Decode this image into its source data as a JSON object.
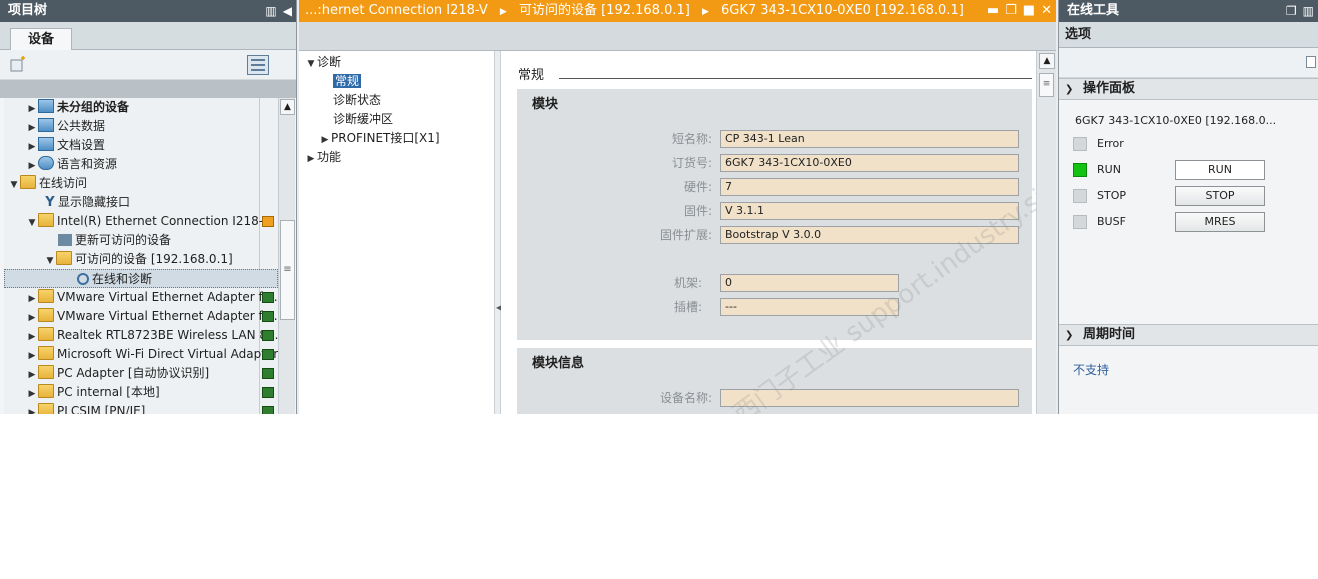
{
  "project_tree": {
    "title": "项目树",
    "tab": "设备",
    "items": [
      {
        "label": "未分组的设备",
        "bold": true
      },
      {
        "label": "公共数据"
      },
      {
        "label": "文档设置"
      },
      {
        "label": "语言和资源"
      },
      {
        "label": "在线访问"
      },
      {
        "label": "显示隐藏接口"
      },
      {
        "label": "Intel(R) Ethernet Connection I218-V"
      },
      {
        "label": "更新可访问的设备"
      },
      {
        "label": "可访问的设备 [192.168.0.1]"
      },
      {
        "label": "在线和诊断"
      },
      {
        "label": "VMware Virtual Ethernet Adapter fo..."
      },
      {
        "label": "VMware Virtual Ethernet Adapter fo..."
      },
      {
        "label": "Realtek RTL8723BE Wireless LAN 80..."
      },
      {
        "label": "Microsoft Wi-Fi Direct Virtual Adapter"
      },
      {
        "label": "PC Adapter [自动协议识别]"
      },
      {
        "label": "PC internal [本地]"
      },
      {
        "label": "PLCSIM [PN/IE]"
      }
    ]
  },
  "center": {
    "breadcrumb": [
      "...:hernet Connection I218-V",
      "可访问的设备 [192.168.0.1]",
      "6GK7 343-1CX10-0XE0 [192.168.0.1]"
    ],
    "nav": [
      {
        "label": "诊断"
      },
      {
        "label": "常规"
      },
      {
        "label": "诊断状态"
      },
      {
        "label": "诊断缓冲区"
      },
      {
        "label": "PROFINET接口[X1]"
      },
      {
        "label": "功能"
      }
    ],
    "section_title": "常规",
    "module_group": {
      "title": "模块",
      "fields": [
        {
          "label": "短名称:",
          "value": "CP 343-1 Lean"
        },
        {
          "label": "订货号:",
          "value": "6GK7 343-1CX10-0XE0"
        },
        {
          "label": "硬件:",
          "value": "7"
        },
        {
          "label": "固件:",
          "value": "V 3.1.1"
        },
        {
          "label": "固件扩展:",
          "value": "Bootstrap V 3.0.0"
        },
        {
          "label": "机架:",
          "value": "0"
        },
        {
          "label": "插槽:",
          "value": "---"
        }
      ]
    },
    "module_info_group": {
      "title": "模块信息",
      "fields": [
        {
          "label": "设备名称:",
          "value": ""
        }
      ]
    },
    "watermark": "西门子工业 support.industry.siemens.com/cs"
  },
  "online_tools": {
    "title": "在线工具",
    "options": "选项",
    "operator_panel": {
      "title": "操作面板",
      "cpu": "6GK7 343-1CX10-0XE0 [192.168.0...",
      "leds": [
        {
          "label": "Error",
          "on": false
        },
        {
          "label": "RUN",
          "on": true,
          "color": "#13c313"
        },
        {
          "label": "STOP",
          "on": false
        },
        {
          "label": "BUSF",
          "on": false
        }
      ],
      "buttons": [
        "RUN",
        "STOP",
        "MRES"
      ]
    },
    "cycle_time": {
      "title": "周期时间",
      "text": "不支持"
    }
  }
}
